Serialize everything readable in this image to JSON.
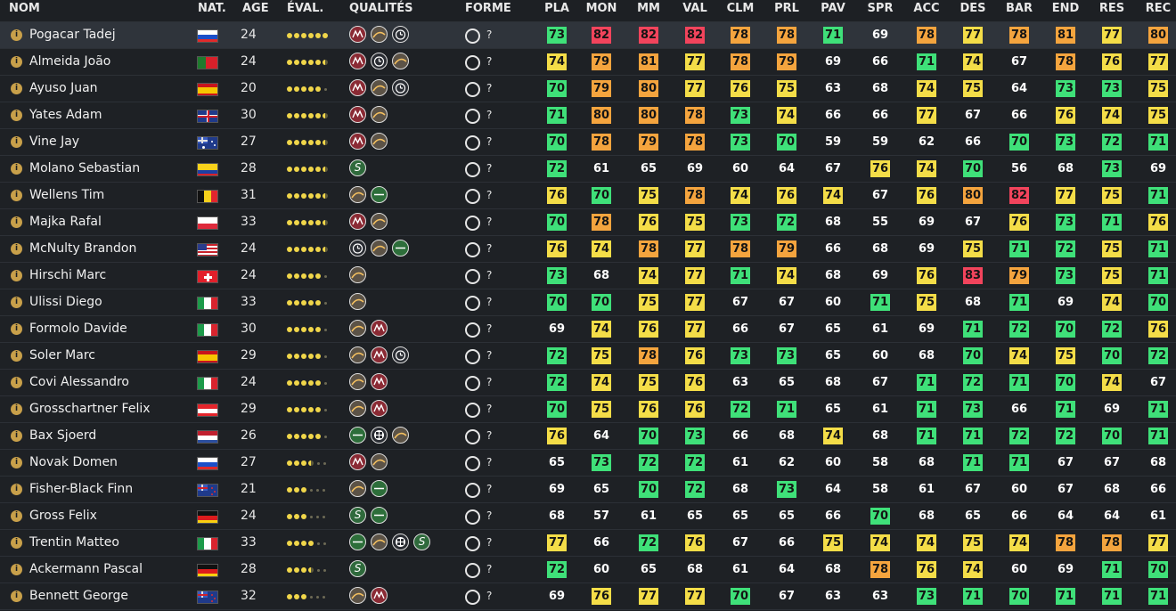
{
  "headers": {
    "nom": "NOM",
    "nat": "NAT.",
    "age": "AGE",
    "eval": "ÉVAL.",
    "qualites": "QUALITÉS",
    "forme": "FORME",
    "stats": [
      "PLA",
      "MON",
      "MM",
      "VAL",
      "CLM",
      "PRL",
      "PAV",
      "SPR",
      "ACC",
      "DES",
      "BAR",
      "END",
      "RES",
      "REC"
    ]
  },
  "colors": {
    "green": "#3fe079",
    "yellow": "#f4dd48",
    "orange": "#f4a43e",
    "red": "#f2445c",
    "background": "#1d2024",
    "selected_row": "#2f343b"
  },
  "info_glyph": "i",
  "forme_unknown": "?",
  "riders": [
    {
      "name": "Pogacar Tadej",
      "nat": "slovenia-flag",
      "age": "24",
      "eval": 6,
      "quals": [
        "mountain",
        "hill",
        "tt"
      ],
      "stats": [
        73,
        82,
        82,
        82,
        78,
        78,
        71,
        69,
        78,
        77,
        78,
        81,
        77,
        80
      ],
      "selected": true
    },
    {
      "name": "Almeida João",
      "nat": "portugal-flag",
      "age": "24",
      "eval": 5.5,
      "quals": [
        "mountain",
        "tt",
        "hill"
      ],
      "stats": [
        74,
        79,
        81,
        77,
        78,
        79,
        69,
        66,
        71,
        74,
        67,
        78,
        76,
        77
      ]
    },
    {
      "name": "Ayuso Juan",
      "nat": "spain-flag",
      "age": "20",
      "eval": 5,
      "quals": [
        "mountain",
        "hill",
        "tt"
      ],
      "stats": [
        70,
        79,
        80,
        77,
        76,
        75,
        63,
        68,
        74,
        75,
        64,
        73,
        73,
        75
      ]
    },
    {
      "name": "Yates Adam",
      "nat": "uk-flag",
      "age": "30",
      "eval": 5.5,
      "quals": [
        "mountain",
        "hill"
      ],
      "stats": [
        71,
        80,
        80,
        78,
        73,
        74,
        66,
        66,
        77,
        67,
        66,
        76,
        74,
        75
      ]
    },
    {
      "name": "Vine Jay",
      "nat": "australia-flag",
      "age": "27",
      "eval": 5.5,
      "quals": [
        "mountain",
        "hill"
      ],
      "stats": [
        70,
        78,
        79,
        78,
        73,
        70,
        59,
        59,
        62,
        66,
        70,
        73,
        72,
        71
      ]
    },
    {
      "name": "Molano Sebastian",
      "nat": "colombia-flag",
      "age": "28",
      "eval": 5.5,
      "quals": [
        "sprint"
      ],
      "stats": [
        72,
        61,
        65,
        69,
        60,
        64,
        67,
        76,
        74,
        70,
        56,
        68,
        73,
        69
      ]
    },
    {
      "name": "Wellens Tim",
      "nat": "belgium-flag",
      "age": "31",
      "eval": 5.5,
      "quals": [
        "hill",
        "flat"
      ],
      "stats": [
        76,
        70,
        75,
        78,
        74,
        76,
        74,
        67,
        76,
        80,
        82,
        77,
        75,
        71
      ]
    },
    {
      "name": "Majka Rafal",
      "nat": "poland-flag",
      "age": "33",
      "eval": 5.5,
      "quals": [
        "mountain",
        "hill"
      ],
      "stats": [
        70,
        78,
        76,
        75,
        73,
        72,
        68,
        55,
        69,
        67,
        76,
        73,
        71,
        76
      ]
    },
    {
      "name": "McNulty Brandon",
      "nat": "usa-flag",
      "age": "24",
      "eval": 5.5,
      "quals": [
        "tt",
        "hill",
        "flat"
      ],
      "stats": [
        76,
        74,
        78,
        77,
        78,
        79,
        66,
        68,
        69,
        75,
        71,
        72,
        75,
        71
      ]
    },
    {
      "name": "Hirschi Marc",
      "nat": "switzerland-flag",
      "age": "24",
      "eval": 5,
      "quals": [
        "hill"
      ],
      "stats": [
        73,
        68,
        74,
        77,
        71,
        74,
        68,
        69,
        76,
        83,
        79,
        73,
        75,
        71
      ]
    },
    {
      "name": "Ulissi Diego",
      "nat": "italy-flag",
      "age": "33",
      "eval": 5,
      "quals": [
        "hill"
      ],
      "stats": [
        70,
        70,
        75,
        77,
        67,
        67,
        60,
        71,
        75,
        68,
        71,
        69,
        74,
        70
      ]
    },
    {
      "name": "Formolo Davide",
      "nat": "italy-flag",
      "age": "30",
      "eval": 5,
      "quals": [
        "hill",
        "mountain"
      ],
      "stats": [
        69,
        74,
        76,
        77,
        66,
        67,
        65,
        61,
        69,
        71,
        72,
        70,
        72,
        76
      ]
    },
    {
      "name": "Soler Marc",
      "nat": "spain-flag",
      "age": "29",
      "eval": 5,
      "quals": [
        "hill",
        "mountain",
        "tt"
      ],
      "stats": [
        72,
        75,
        78,
        76,
        73,
        73,
        65,
        60,
        68,
        70,
        74,
        75,
        70,
        72
      ]
    },
    {
      "name": "Covi Alessandro",
      "nat": "italy-flag",
      "age": "24",
      "eval": 5,
      "quals": [
        "hill",
        "mountain"
      ],
      "stats": [
        72,
        74,
        75,
        76,
        63,
        65,
        68,
        67,
        71,
        72,
        71,
        70,
        74,
        67
      ]
    },
    {
      "name": "Grosschartner Felix",
      "nat": "austria-flag",
      "age": "29",
      "eval": 5,
      "quals": [
        "hill",
        "mountain"
      ],
      "stats": [
        70,
        75,
        76,
        76,
        72,
        71,
        65,
        61,
        71,
        73,
        66,
        71,
        69,
        71
      ]
    },
    {
      "name": "Bax Sjoerd",
      "nat": "netherlands-flag",
      "age": "26",
      "eval": 5,
      "quals": [
        "flat",
        "cobble",
        "hill"
      ],
      "stats": [
        76,
        64,
        70,
        73,
        66,
        68,
        74,
        68,
        71,
        71,
        72,
        72,
        70,
        71
      ]
    },
    {
      "name": "Novak Domen",
      "nat": "slovenia-flag",
      "age": "27",
      "eval": 3.5,
      "quals": [
        "mountain",
        "hill"
      ],
      "stats": [
        65,
        73,
        72,
        72,
        61,
        62,
        60,
        58,
        68,
        71,
        71,
        67,
        67,
        68
      ]
    },
    {
      "name": "Fisher-Black Finn",
      "nat": "newzealand-flag",
      "age": "21",
      "eval": 3,
      "quals": [
        "hill",
        "flat"
      ],
      "stats": [
        69,
        65,
        70,
        72,
        68,
        73,
        64,
        58,
        61,
        67,
        60,
        67,
        68,
        66
      ]
    },
    {
      "name": "Gross Felix",
      "nat": "germany-flag",
      "age": "24",
      "eval": 3,
      "quals": [
        "sprint",
        "flat"
      ],
      "stats": [
        68,
        57,
        61,
        65,
        65,
        65,
        66,
        70,
        68,
        65,
        66,
        64,
        64,
        61
      ]
    },
    {
      "name": "Trentin Matteo",
      "nat": "italy-flag",
      "age": "33",
      "eval": 4,
      "quals": [
        "flat",
        "hill",
        "cobble",
        "sprint"
      ],
      "stats": [
        77,
        66,
        72,
        76,
        67,
        66,
        75,
        74,
        74,
        75,
        74,
        78,
        78,
        77
      ]
    },
    {
      "name": "Ackermann Pascal",
      "nat": "germany-flag",
      "age": "28",
      "eval": 3.5,
      "quals": [
        "sprint"
      ],
      "stats": [
        72,
        60,
        65,
        68,
        61,
        64,
        68,
        78,
        76,
        74,
        60,
        69,
        71,
        70
      ]
    },
    {
      "name": "Bennett George",
      "nat": "newzealand-flag",
      "age": "32",
      "eval": 3,
      "quals": [
        "hill",
        "mountain"
      ],
      "stats": [
        69,
        76,
        77,
        77,
        70,
        67,
        63,
        63,
        73,
        71,
        70,
        71,
        71,
        71
      ]
    }
  ]
}
